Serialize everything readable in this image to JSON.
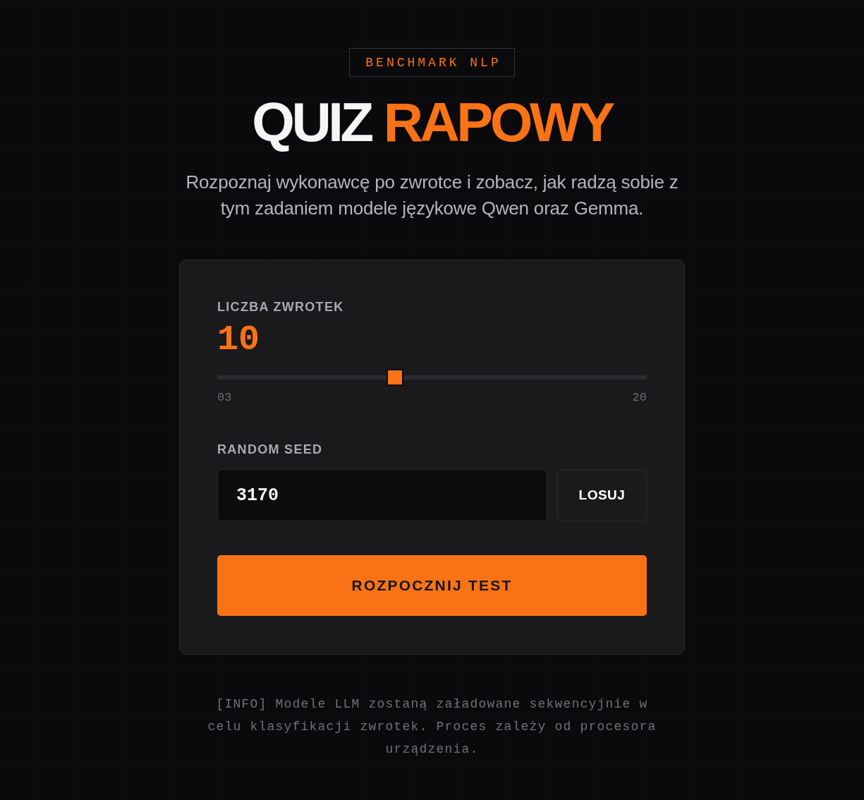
{
  "badge": "BENCHMARK NLP",
  "title": [
    {
      "text": "QUIZ",
      "accent": false
    },
    {
      "text": "RAPOWY",
      "accent": true
    }
  ],
  "subtitle": "Rozpoznaj wykonawcę po zwrotce i zobacz, jak radzą sobie z tym zadaniem modele językowe Qwen oraz Gemma.",
  "card": {
    "slider": {
      "label": "LICZBA ZWROTEK",
      "value": "10",
      "level": 0.41,
      "min_label": "03",
      "max_label": "20"
    },
    "seed": {
      "label": "RANDOM SEED",
      "value": "3170",
      "button": "LOSUJ"
    },
    "start_button": "ROZPOCZNIJ TEST"
  },
  "info": "[INFO] Modele LLM zostaną załadowane sekwencyjnie w celu klasyfikacji zwrotek. Proces zależy od procesora urządzenia."
}
